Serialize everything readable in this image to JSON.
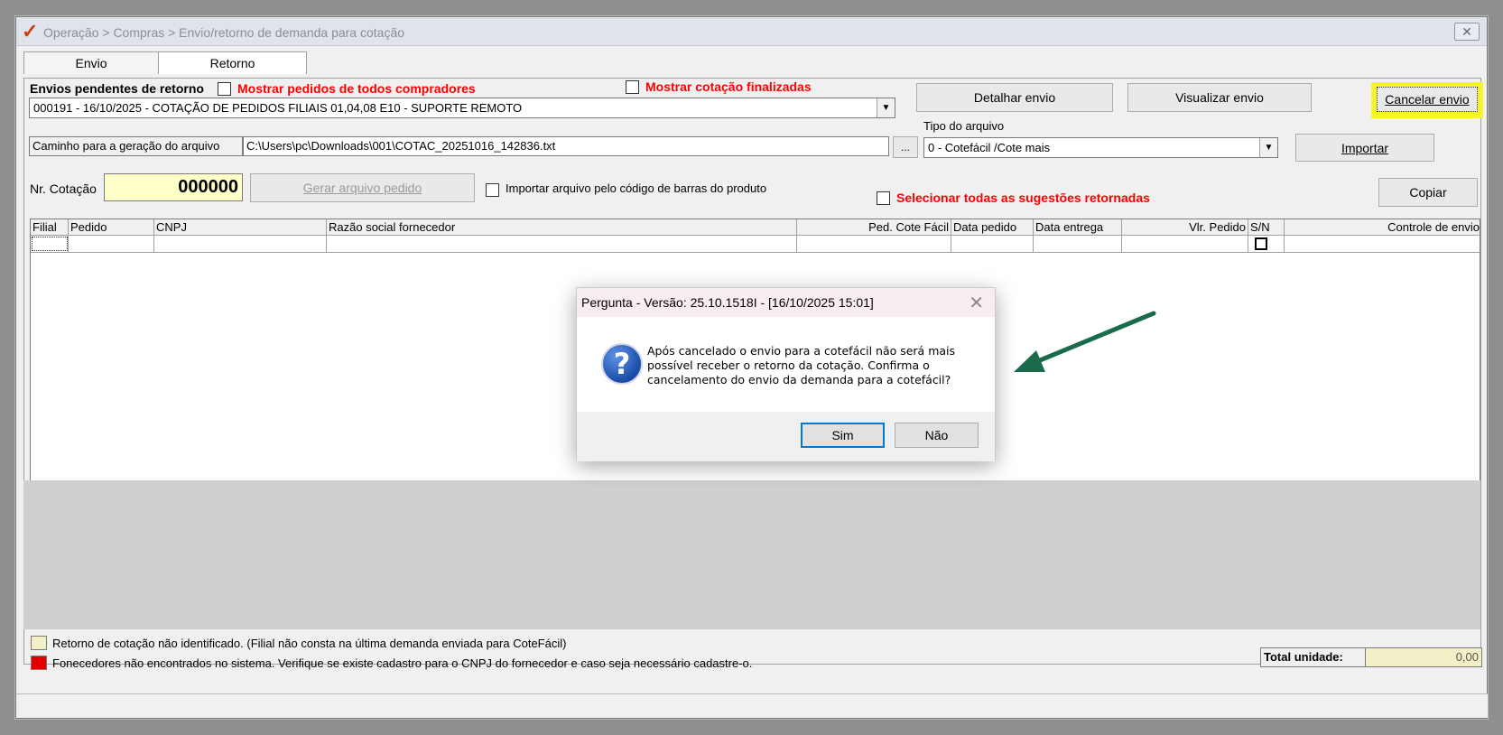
{
  "window": {
    "title": "Operação > Compras > Envio/retorno de demanda para cotação",
    "close_glyph": "✕"
  },
  "tabs": [
    {
      "label": "Envio"
    },
    {
      "label": "Retorno"
    }
  ],
  "retorno": {
    "pending_label": "Envios pendentes de retorno",
    "show_all_buyers": "Mostrar pedidos de todos compradores",
    "show_finished": "Mostrar cotação finalizadas",
    "pending_selected": "000191 - 16/10/2025 - COTAÇÃO DE PEDIDOS FILIAIS 01,04,08 E10 - SUPORTE REMOTO",
    "btn_detalhar": "Detalhar envio",
    "btn_visualizar": "Visualizar envio",
    "btn_cancelar": "Cancelar envio",
    "path_label": "Caminho para a geração do arquivo",
    "path_value": "C:\\Users\\pc\\Downloads\\001\\COTAC_20251016_142836.txt",
    "browse_label": "...",
    "file_type_label": "Tipo do arquivo",
    "file_type_value": "0 - Cotefácil /Cote mais",
    "btn_importar": "Importar",
    "nr_cotacao_label": "Nr. Cotação",
    "nr_cotacao_value": "000000",
    "btn_gerar": "Gerar arquivo pedido",
    "import_barcode": "Importar arquivo pelo código de barras do produto",
    "select_all": "Selecionar todas as sugestões retornadas",
    "btn_copiar": "Copiar"
  },
  "grid": {
    "columns": [
      "Filial",
      "Pedido",
      "CNPJ",
      "Razão social fornecedor",
      "Ped. Cote Fácil",
      "Data pedido",
      "Data entrega",
      "Vlr. Pedido",
      "S/N",
      "Controle de envio"
    ]
  },
  "legend": {
    "yellow": "Retorno de cotação não identificado. (Filial não consta na última demanda enviada para CoteFácil)",
    "red": "Fonecedores não encontrados no sistema. Verifique se existe cadastro para o CNPJ do fornecedor e caso seja necessário cadastre-o.",
    "total_label": "Total unidade:",
    "total_value": "0,00"
  },
  "dialog": {
    "title": "Pergunta - Versão: 25.10.1518I - [16/10/2025 15:01]",
    "close_glyph": "✕",
    "message": "Após cancelado o envio para a cotefácil não será mais possível receber o retorno da cotação. Confirma o cancelamento do envio da demanda para a cotefácil?",
    "btn_sim": "Sim",
    "btn_nao": "Não"
  },
  "colors": {
    "highlight": "#f5f528",
    "red_text": "#ff0000",
    "arrow": "#1a6b4a",
    "legend_yellow": "#f3efc6",
    "legend_red": "#e00000"
  }
}
